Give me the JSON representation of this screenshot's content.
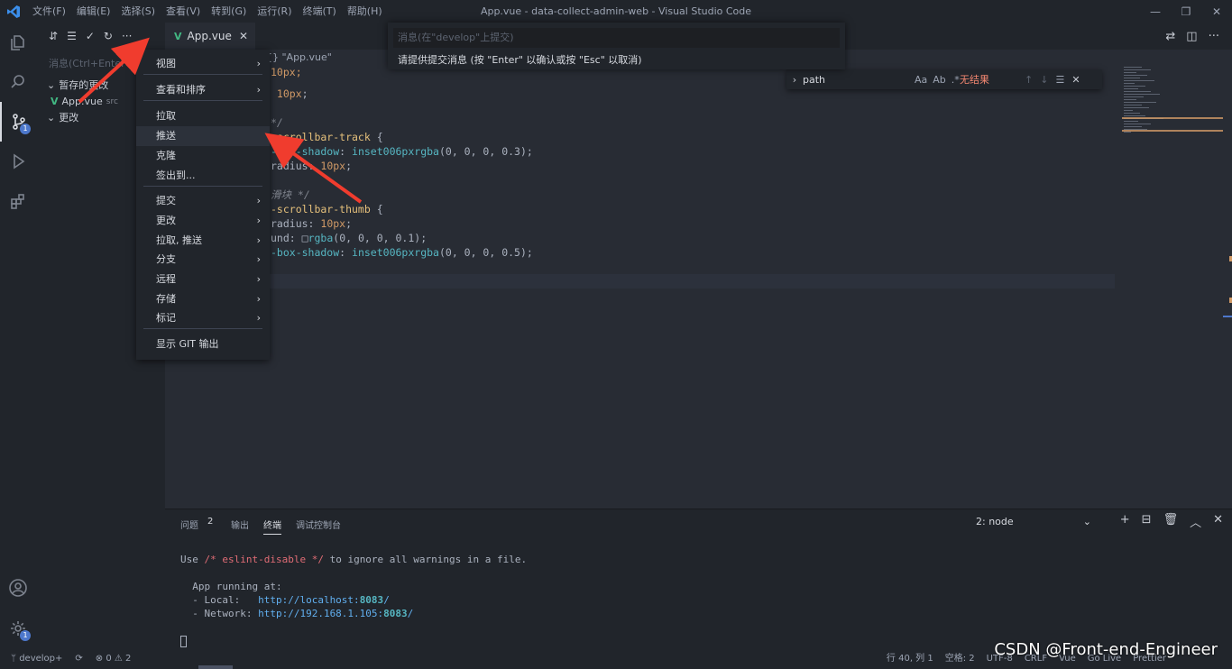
{
  "window": {
    "title": "App.vue - data-collect-admin-web - Visual Studio Code",
    "menu": [
      "文件(F)",
      "编辑(E)",
      "选择(S)",
      "查看(V)",
      "转到(G)",
      "运行(R)",
      "终端(T)",
      "帮助(H)"
    ],
    "controls": [
      "—",
      "❐",
      "✕"
    ]
  },
  "activity_bar": {
    "scm_badge": "1",
    "settings_badge": "1"
  },
  "sidebar": {
    "toolbar": [
      "⇵",
      "☰",
      "✓",
      "↻",
      "···"
    ],
    "commit_placeholder": "消息(Ctrl+Enter 在",
    "groups": [
      {
        "label": "暂存的更改",
        "files": [
          {
            "name": "App.vue",
            "path": "src"
          }
        ]
      },
      {
        "label": "更改",
        "files": []
      }
    ]
  },
  "tab": {
    "label": "App.vue",
    "close": "✕"
  },
  "breadcrumb": "{} \"App.vue\"",
  "code_lines": [
    {
      "parts": [
        {
          "t": "10px;",
          "c": "c-num"
        }
      ]
    },
    {
      "parts": [
        {
          "t": " 10px",
          "c": "c-num"
        },
        {
          "t": ";",
          "c": ""
        }
      ]
    },
    {
      "parts": []
    },
    {
      "parts": [
        {
          "t": "*/",
          "c": "c-cmt"
        }
      ]
    },
    {
      "parts": [
        {
          "t": "-scrollbar-track ",
          "c": "c-sel"
        },
        {
          "t": "{",
          "c": ""
        }
      ]
    },
    {
      "parts": [
        {
          "t": "-box-shadow",
          "c": "c-prop"
        },
        {
          "t": ": ",
          "c": ""
        },
        {
          "t": "inset006pxrgba",
          "c": "c-fn"
        },
        {
          "t": "(0, 0, 0, 0.3);",
          "c": ""
        }
      ]
    },
    {
      "parts": [
        {
          "t": "radius",
          "c": ""
        },
        {
          "t": ": ",
          "c": ""
        },
        {
          "t": "10px",
          "c": "c-num"
        },
        {
          "t": ";",
          "c": ""
        }
      ]
    },
    {
      "parts": []
    },
    {
      "parts": [
        {
          "t": "滑块 */",
          "c": "c-cmt"
        }
      ]
    },
    {
      "parts": [
        {
          "t": "-scrollbar-thumb ",
          "c": "c-sel"
        },
        {
          "t": "{",
          "c": ""
        }
      ]
    },
    {
      "parts": [
        {
          "t": "radius",
          "c": ""
        },
        {
          "t": ": ",
          "c": ""
        },
        {
          "t": "10px",
          "c": "c-num"
        },
        {
          "t": ";",
          "c": ""
        }
      ]
    },
    {
      "parts": [
        {
          "t": "und: ",
          "c": ""
        },
        {
          "t": "□",
          "c": ""
        },
        {
          "t": "rgba",
          "c": "c-fn"
        },
        {
          "t": "(0, 0, 0, 0.1);",
          "c": ""
        }
      ]
    },
    {
      "parts": [
        {
          "t": "-box-shadow",
          "c": "c-prop"
        },
        {
          "t": ": ",
          "c": ""
        },
        {
          "t": "inset006pxrgba",
          "c": "c-fn"
        },
        {
          "t": "(0, 0, 0, 0.5);",
          "c": ""
        }
      ]
    }
  ],
  "find_widget": {
    "query": "path",
    "options": [
      "Aa",
      "Ab",
      ".*"
    ],
    "result": "无结果",
    "nav": [
      "↑",
      "↓",
      "☰",
      "✕"
    ]
  },
  "quick_input": {
    "placeholder": "消息(在\"develop\"上提交)",
    "message": "请提供提交消息 (按 \"Enter\" 以确认或按 \"Esc\" 以取消)"
  },
  "context_menu": [
    {
      "label": "视图",
      "sub": true
    },
    {
      "label": "查看和排序",
      "sub": true
    },
    {
      "label": "拉取",
      "sub": false
    },
    {
      "label": "推送",
      "sub": false,
      "highlight": true
    },
    {
      "label": "克隆",
      "sub": false
    },
    {
      "label": "签出到...",
      "sub": false
    },
    {
      "label": "提交",
      "sub": true
    },
    {
      "label": "更改",
      "sub": true
    },
    {
      "label": "拉取, 推送",
      "sub": true
    },
    {
      "label": "分支",
      "sub": true
    },
    {
      "label": "远程",
      "sub": true
    },
    {
      "label": "存储",
      "sub": true
    },
    {
      "label": "标记",
      "sub": true
    },
    {
      "label": "显示 GIT 输出",
      "sub": false
    }
  ],
  "panel": {
    "tabs": [
      "问题",
      "输出",
      "终端",
      "调试控制台"
    ],
    "problems_count": "2",
    "terminal_select": "2: node",
    "actions": [
      "+",
      "⊟",
      "🗑",
      "︿",
      "✕"
    ],
    "terminal": {
      "line1_a": "Use ",
      "line1_cmt": "/* eslint-disable */",
      "line1_b": " to ignore all warnings in a file.",
      "line2": "  App running at:",
      "local_label": "  - Local:   ",
      "local_url_a": "http://localhost:",
      "local_port": "8083",
      "local_url_b": "/",
      "net_label": "  - Network: ",
      "net_url_a": "http://192.168.1.105:",
      "net_port": "8083",
      "net_url_b": "/"
    }
  },
  "status_bar": {
    "branch": "develop+",
    "sync": "⟳",
    "problems": "⊗ 0 ⚠ 2",
    "position": "行 40, 列 1",
    "spaces": "空格: 2",
    "encoding": "UTF-8",
    "eol": "CRLF",
    "language": "Vue",
    "golive": "Go Live",
    "prettier": "Prettier"
  },
  "watermark": "CSDN @Front-end-Engineer"
}
